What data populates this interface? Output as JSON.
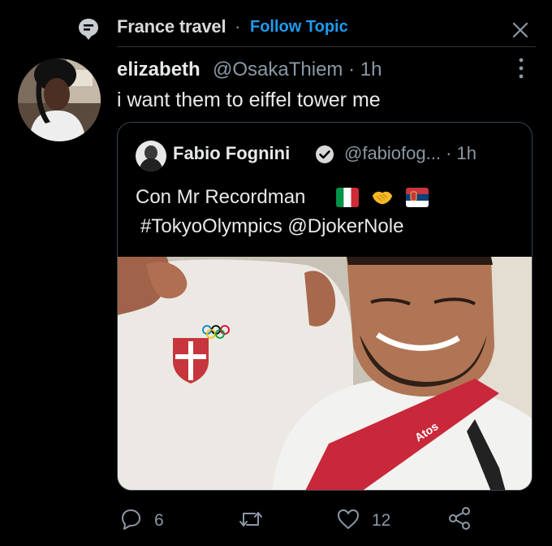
{
  "topic": {
    "name": "France travel",
    "separator": "·",
    "follow_label": "Follow Topic"
  },
  "tweet": {
    "author_name": "elizabeth",
    "author_handle": "@OsakaThiem · 1h",
    "text": "i want them to eiffel tower me",
    "quoted": {
      "author_name": "Fabio Fognini",
      "author_handle": "@fabiofog... · 1h",
      "text_line1": "Con Mr Recordman",
      "text_line2": "#TokyoOlympics @DjokerNole",
      "flags": [
        "italy-flag",
        "handshake-emoji",
        "serbia-flag"
      ],
      "photo_text": [
        "Atos"
      ]
    },
    "actions": {
      "reply_count": "6",
      "retweet_count": "",
      "like_count": "12"
    }
  },
  "colors": {
    "background": "#000000",
    "accent": "#1d9bf0",
    "muted": "#8b98a5",
    "border": "#38444d"
  }
}
